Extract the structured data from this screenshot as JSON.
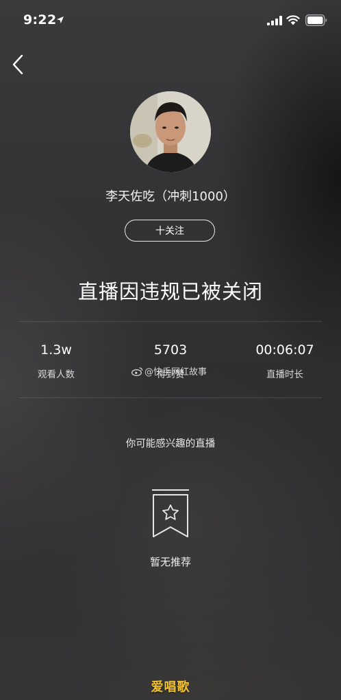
{
  "status_bar": {
    "time": "9:22",
    "location_icon": "location-arrow-icon",
    "signal_icon": "cellular-signal-icon",
    "wifi_icon": "wifi-icon",
    "battery_icon": "battery-icon"
  },
  "nav": {
    "back_icon": "chevron-left-icon"
  },
  "streamer": {
    "name": "李天佐吃（冲刺1000）",
    "follow_label": "十关注"
  },
  "closed_message": "直播因违规已被关闭",
  "stats": {
    "viewers": {
      "value": "1.3w",
      "label": "观看人数"
    },
    "likes": {
      "value": "5703",
      "label": "得到赞"
    },
    "duration": {
      "value": "00:06:07",
      "label": "直播时长"
    }
  },
  "overlay_watermark": {
    "text": "@快手网红故事",
    "icon": "weibo-icon"
  },
  "recommendations": {
    "heading": "你可能感兴趣的直播",
    "empty_icon": "bookmark-star-icon",
    "empty_text": "暂无推荐"
  },
  "bottom_watermark": "爱唱歌",
  "colors": {
    "background": "#2b2b2d",
    "text": "#ffffff",
    "watermark_yellow": "#f2c230"
  }
}
